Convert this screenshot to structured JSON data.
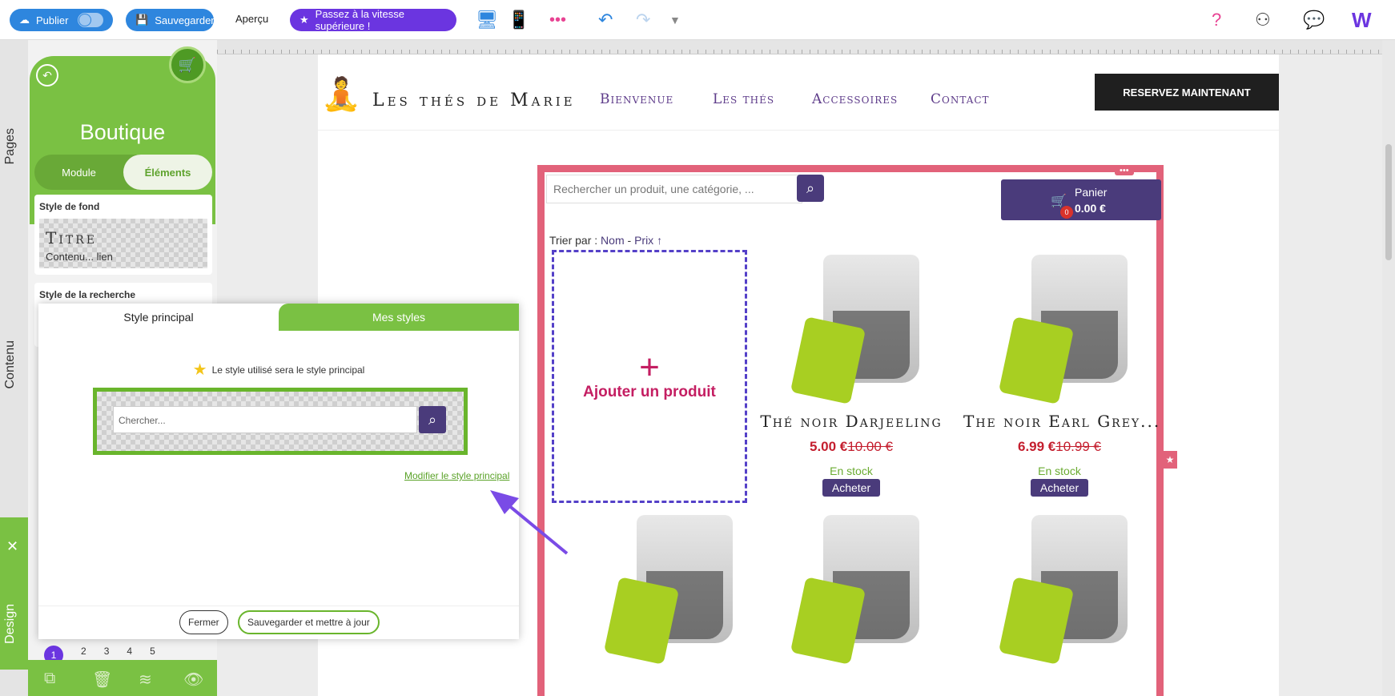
{
  "toolbar": {
    "publish_label": "Publier",
    "save_label": "Sauvegarder",
    "preview_label": "Aperçu",
    "upgrade_label": "Passez à la vitesse supérieure !"
  },
  "left_tabs": {
    "pages": "Pages",
    "content": "Contenu",
    "design": "Design"
  },
  "panel": {
    "title": "Boutique",
    "tabs": [
      "Module",
      "Éléments"
    ],
    "active_tab": "Éléments",
    "cards": [
      {
        "label": "Style de fond",
        "preview_title": "Titre",
        "preview_text": "Contenu... lien"
      },
      {
        "label": "Style de la recherche"
      }
    ],
    "pager": [
      "1",
      "2",
      "3",
      "4",
      "5"
    ]
  },
  "site": {
    "name": "Les thés de Marie",
    "nav": [
      "Bienvenue",
      "Les thés",
      "Accessoires",
      "Contact"
    ],
    "cta": "RESERVEZ MAINTENANT"
  },
  "shop": {
    "search_placeholder": "Rechercher un produit, une catégorie, ...",
    "cart_label": "Panier",
    "cart_total": "0.00 €",
    "cart_count": "0",
    "sort_label": "Trier par :",
    "sort_name": "Nom",
    "sort_price": "Prix ↑",
    "add_product": "Ajouter un produit",
    "products": [
      {
        "name": "Thé noir Darjeeling",
        "price": "5.00 €",
        "old_price": "10.00 €",
        "stock": "En stock",
        "buy": "Acheter"
      },
      {
        "name": "The noir Earl Grey...",
        "price": "6.99 €",
        "old_price": "10.99 €",
        "stock": "En stock",
        "buy": "Acheter"
      }
    ]
  },
  "modal": {
    "tab_main": "Style principal",
    "tab_my": "Mes styles",
    "info": "Le style utilisé sera le style principal",
    "preview_placeholder": "Chercher...",
    "modify_link": "Modifier le style principal",
    "close": "Fermer",
    "save_update": "Sauvegarder et mettre à jour"
  },
  "colors": {
    "accent_blue": "#2e86de",
    "accent_green": "#7ac143",
    "accent_purple": "#6b35e0",
    "shop_border": "#e2627a",
    "brand_purple": "#4a3b7b"
  }
}
